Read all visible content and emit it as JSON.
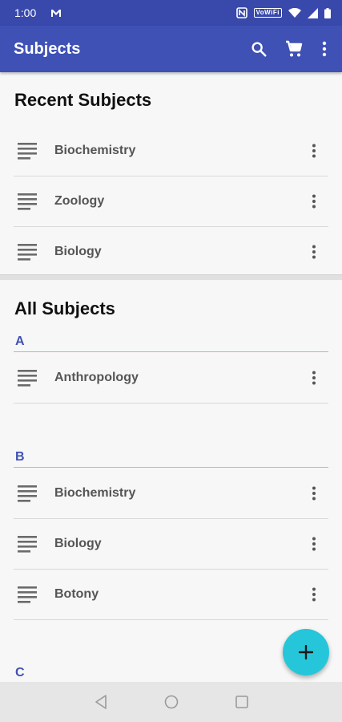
{
  "status_bar": {
    "time": "1:00",
    "badge": "VoWiFi"
  },
  "app_bar": {
    "title": "Subjects"
  },
  "recent": {
    "title": "Recent Subjects",
    "items": [
      {
        "label": "Biochemistry"
      },
      {
        "label": "Zoology"
      },
      {
        "label": "Biology"
      }
    ]
  },
  "all": {
    "title": "All Subjects",
    "groups": [
      {
        "letter": "A",
        "items": [
          {
            "label": "Anthropology"
          }
        ]
      },
      {
        "letter": "B",
        "items": [
          {
            "label": "Biochemistry"
          },
          {
            "label": "Biology"
          },
          {
            "label": "Botony"
          }
        ]
      },
      {
        "letter": "C",
        "items": []
      }
    ]
  },
  "fab": {
    "label": "+"
  },
  "colors": {
    "primary": "#3f51b5",
    "status": "#3949ab",
    "accent": "#26c6da",
    "section_rule": "#e9a0ad"
  }
}
